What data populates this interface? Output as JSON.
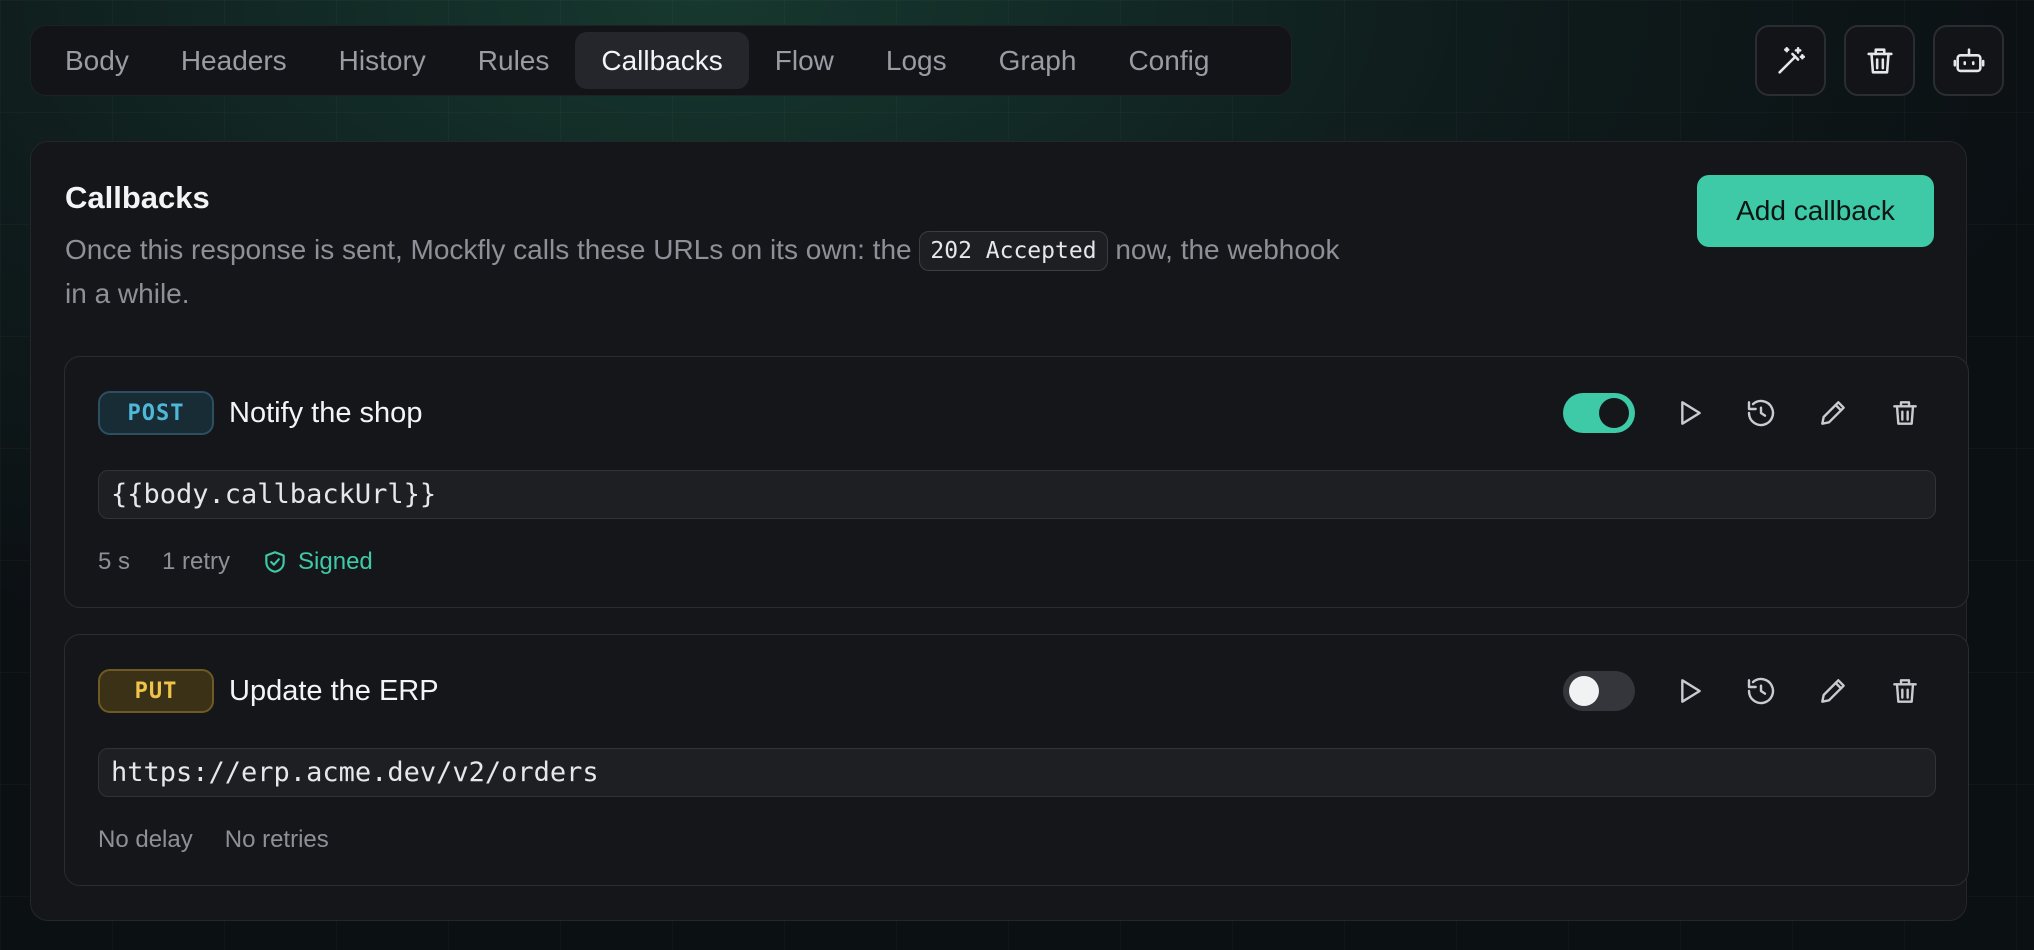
{
  "tabs": [
    {
      "label": "Body",
      "active": false
    },
    {
      "label": "Headers",
      "active": false
    },
    {
      "label": "History",
      "active": false
    },
    {
      "label": "Rules",
      "active": false
    },
    {
      "label": "Callbacks",
      "active": true
    },
    {
      "label": "Flow",
      "active": false
    },
    {
      "label": "Logs",
      "active": false
    },
    {
      "label": "Graph",
      "active": false
    },
    {
      "label": "Config",
      "active": false
    }
  ],
  "top_actions": [
    {
      "icon": "magic-wand-icon"
    },
    {
      "icon": "trash-icon"
    },
    {
      "icon": "robot-icon"
    }
  ],
  "panel": {
    "title": "Callbacks",
    "description_before": "Once this response is sent, Mockfly calls these URLs on its own: the",
    "description_code": "202 Accepted",
    "description_after": "now, the webhook in a while.",
    "add_button": "Add callback"
  },
  "callbacks": [
    {
      "method": "POST",
      "name": "Notify the shop",
      "enabled": true,
      "url": "{{body.callbackUrl}}",
      "delay": "5 s",
      "retries": "1 retry",
      "signed": "Signed"
    },
    {
      "method": "PUT",
      "name": "Update the ERP",
      "enabled": false,
      "url": "https://erp.acme.dev/v2/orders",
      "delay": "No delay",
      "retries": "No retries"
    }
  ],
  "colors": {
    "accent": "#3ec9a7",
    "post": "#4fb8d8",
    "put": "#f0c44a",
    "panel_bg": "#15161a"
  }
}
